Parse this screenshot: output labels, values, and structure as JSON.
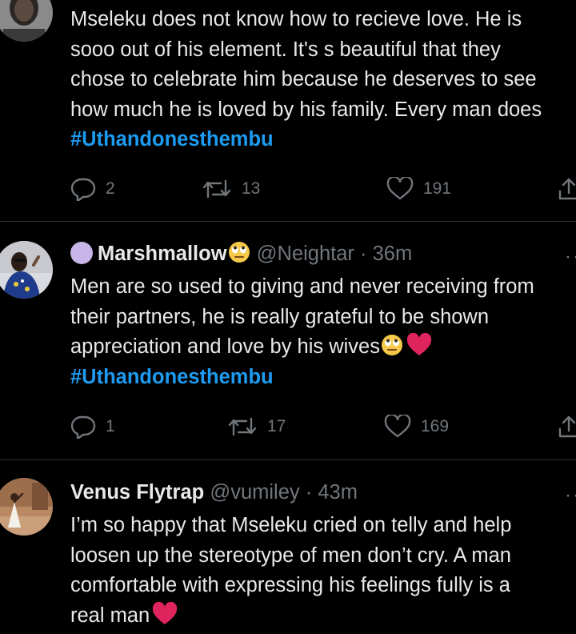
{
  "colors": {
    "background": "#000000",
    "text": "#e7e9ea",
    "muted": "#71767b",
    "link": "#1d9bf0",
    "divider": "#2f3336",
    "heart": "#e0245e"
  },
  "tweets": [
    {
      "lines": [
        "Mseleku does not know how to recieve love. He is",
        "sooo out of his element. It's s beautiful that they",
        "chose to celebrate him because he deserves to see",
        "how much he is loved by his family. Every man does"
      ],
      "hashtag": "#Uthandonesthembu",
      "replies": "2",
      "retweets": "13",
      "likes": "191",
      "icons": [
        "reply-icon",
        "retweet-icon",
        "like-icon",
        "share-icon"
      ]
    },
    {
      "name": "Marshmallow",
      "handle": "@Neightar",
      "separator": "·",
      "time": "36m",
      "lines": [
        "Men are so used to giving and never receiving from",
        "their partners, he is really grateful to be shown",
        "appreciation and love by his wives"
      ],
      "hashtag": "#Uthandonesthembu",
      "replies": "1",
      "retweets": "17",
      "likes": "169"
    },
    {
      "name": "Venus Flytrap",
      "handle": "@vumiley",
      "separator": "·",
      "time": "43m",
      "lines": [
        "I’m so happy that Mseleku cried on telly and help",
        "loosen up the stereotype of men don’t cry. A man",
        "comfortable with expressing his feelings fully is a",
        "real man"
      ]
    }
  ],
  "more_glyph": "··"
}
